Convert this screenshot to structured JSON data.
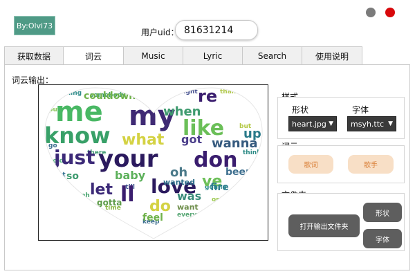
{
  "app": {
    "logo_text": "By:Olvi73",
    "window_controls": {
      "minimize_color": "#7b7b7b",
      "close_color": "#d8080b"
    }
  },
  "user": {
    "uid_label": "用户uid：",
    "uid_value": "81631214"
  },
  "tabs": [
    {
      "label": "获取数据",
      "active": false
    },
    {
      "label": "词云",
      "active": true
    },
    {
      "label": "Music",
      "active": false
    },
    {
      "label": "Lyric",
      "active": false
    },
    {
      "label": "Search",
      "active": false
    },
    {
      "label": "使用说明",
      "active": false
    }
  ],
  "output": {
    "label": "词云输出："
  },
  "sidebar": {
    "style": {
      "title": "样式",
      "shape_label": "形状",
      "font_label": "字体",
      "shape_value": "heart.jpg",
      "font_value": "msyh.ttc"
    },
    "wordcloud": {
      "title": "词云",
      "lyrics_button": "歌词",
      "singer_button": "歌手"
    },
    "folder": {
      "title": "文件夹",
      "open_output_button": "打开输出文件夹",
      "shape_button": "形状",
      "font_button": "字体"
    }
  },
  "colors": {
    "accent_peach": "#f8dfc6",
    "peach_text": "#d97e36",
    "logo_bg": "#4f9a86"
  }
}
